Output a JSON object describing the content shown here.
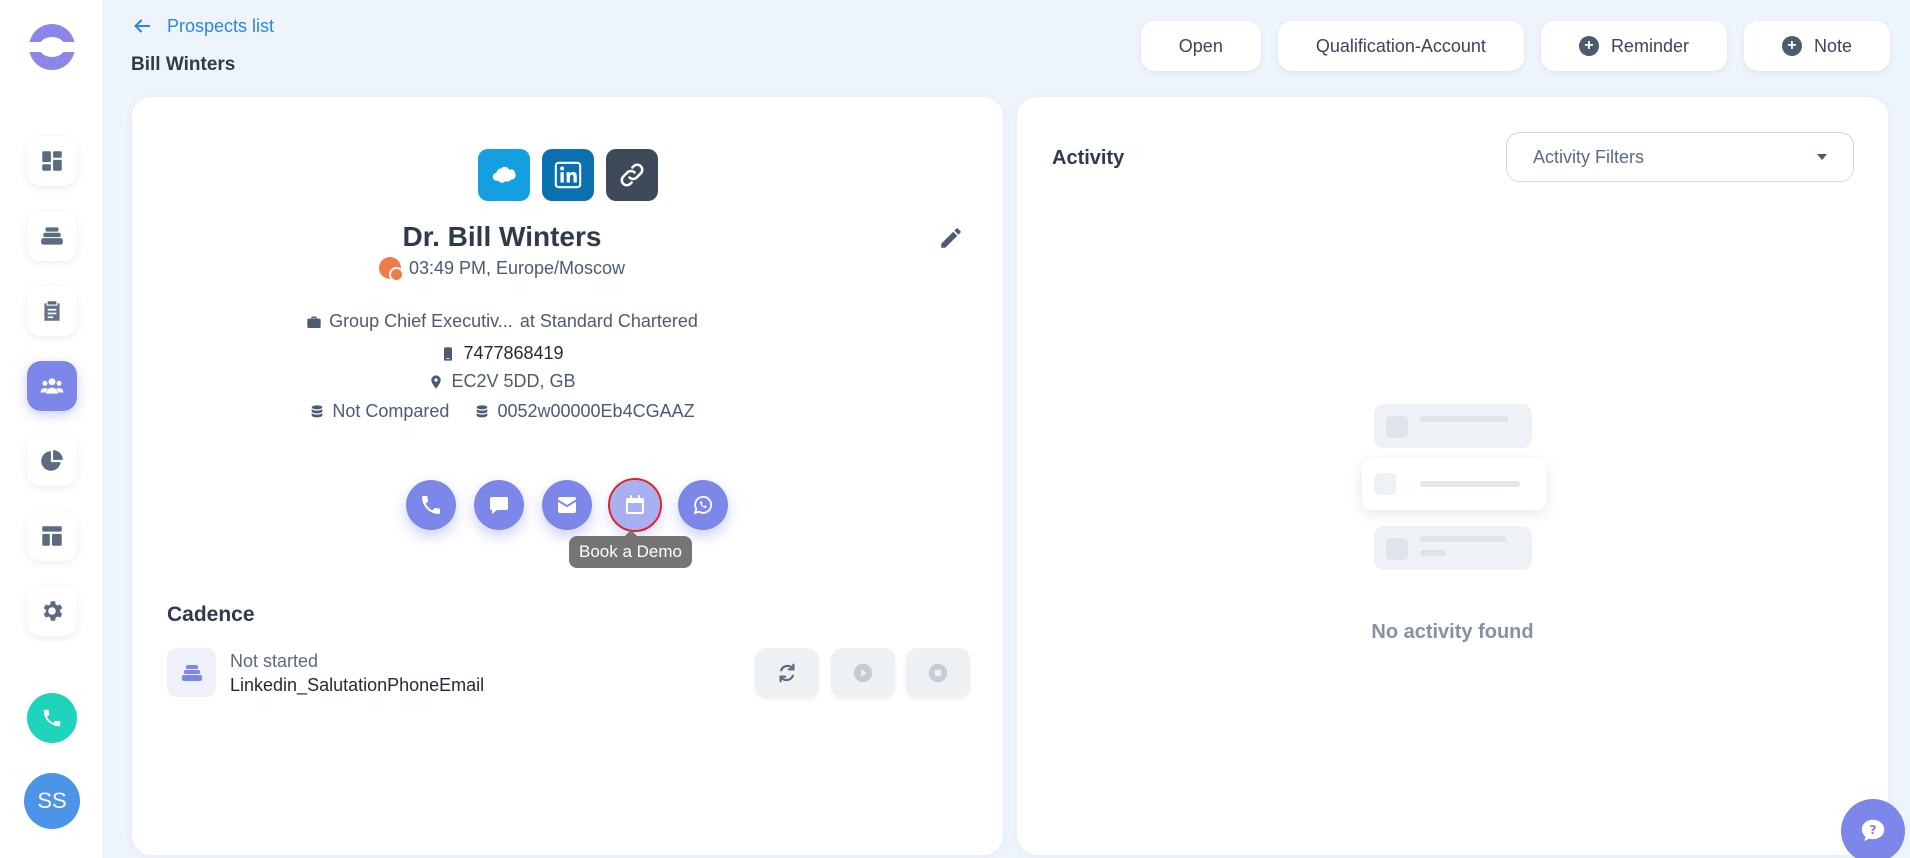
{
  "header": {
    "back_label": "Prospects list",
    "page_title": "Bill Winters",
    "actions": {
      "open": "Open",
      "qualification": "Qualification-Account",
      "reminder": "Reminder",
      "note": "Note"
    }
  },
  "sidebar": {
    "items": [
      {
        "name": "dashboard",
        "icon": "grid-icon"
      },
      {
        "name": "cadences",
        "icon": "layers-icon"
      },
      {
        "name": "tasks",
        "icon": "clipboard-icon"
      },
      {
        "name": "prospects",
        "icon": "users-icon",
        "active": true
      },
      {
        "name": "reports",
        "icon": "pie-chart-icon"
      },
      {
        "name": "templates",
        "icon": "layout-icon"
      },
      {
        "name": "settings",
        "icon": "gear-icon"
      }
    ],
    "avatar_initials": "SS"
  },
  "profile": {
    "name": "Dr. Bill Winters",
    "local_time": "03:49 PM, Europe/Moscow",
    "title": "Group Chief Executiv...",
    "at_company": "at Standard Chartered",
    "phone": "7477868419",
    "location": "EC2V 5DD, GB",
    "compare_status": "Not Compared",
    "crm_id": "0052w00000Eb4CGAAZ",
    "tooltip": "Book a Demo"
  },
  "cadence": {
    "title": "Cadence",
    "status": "Not started",
    "name": "Linkedin_SalutationPhoneEmail"
  },
  "activity": {
    "title": "Activity",
    "filter_label": "Activity Filters",
    "empty_text": "No activity found"
  },
  "colors": {
    "accent": "#7d87ea",
    "link": "#2a86e0",
    "background": "#eef4fb",
    "call": "#1fd4bd"
  }
}
